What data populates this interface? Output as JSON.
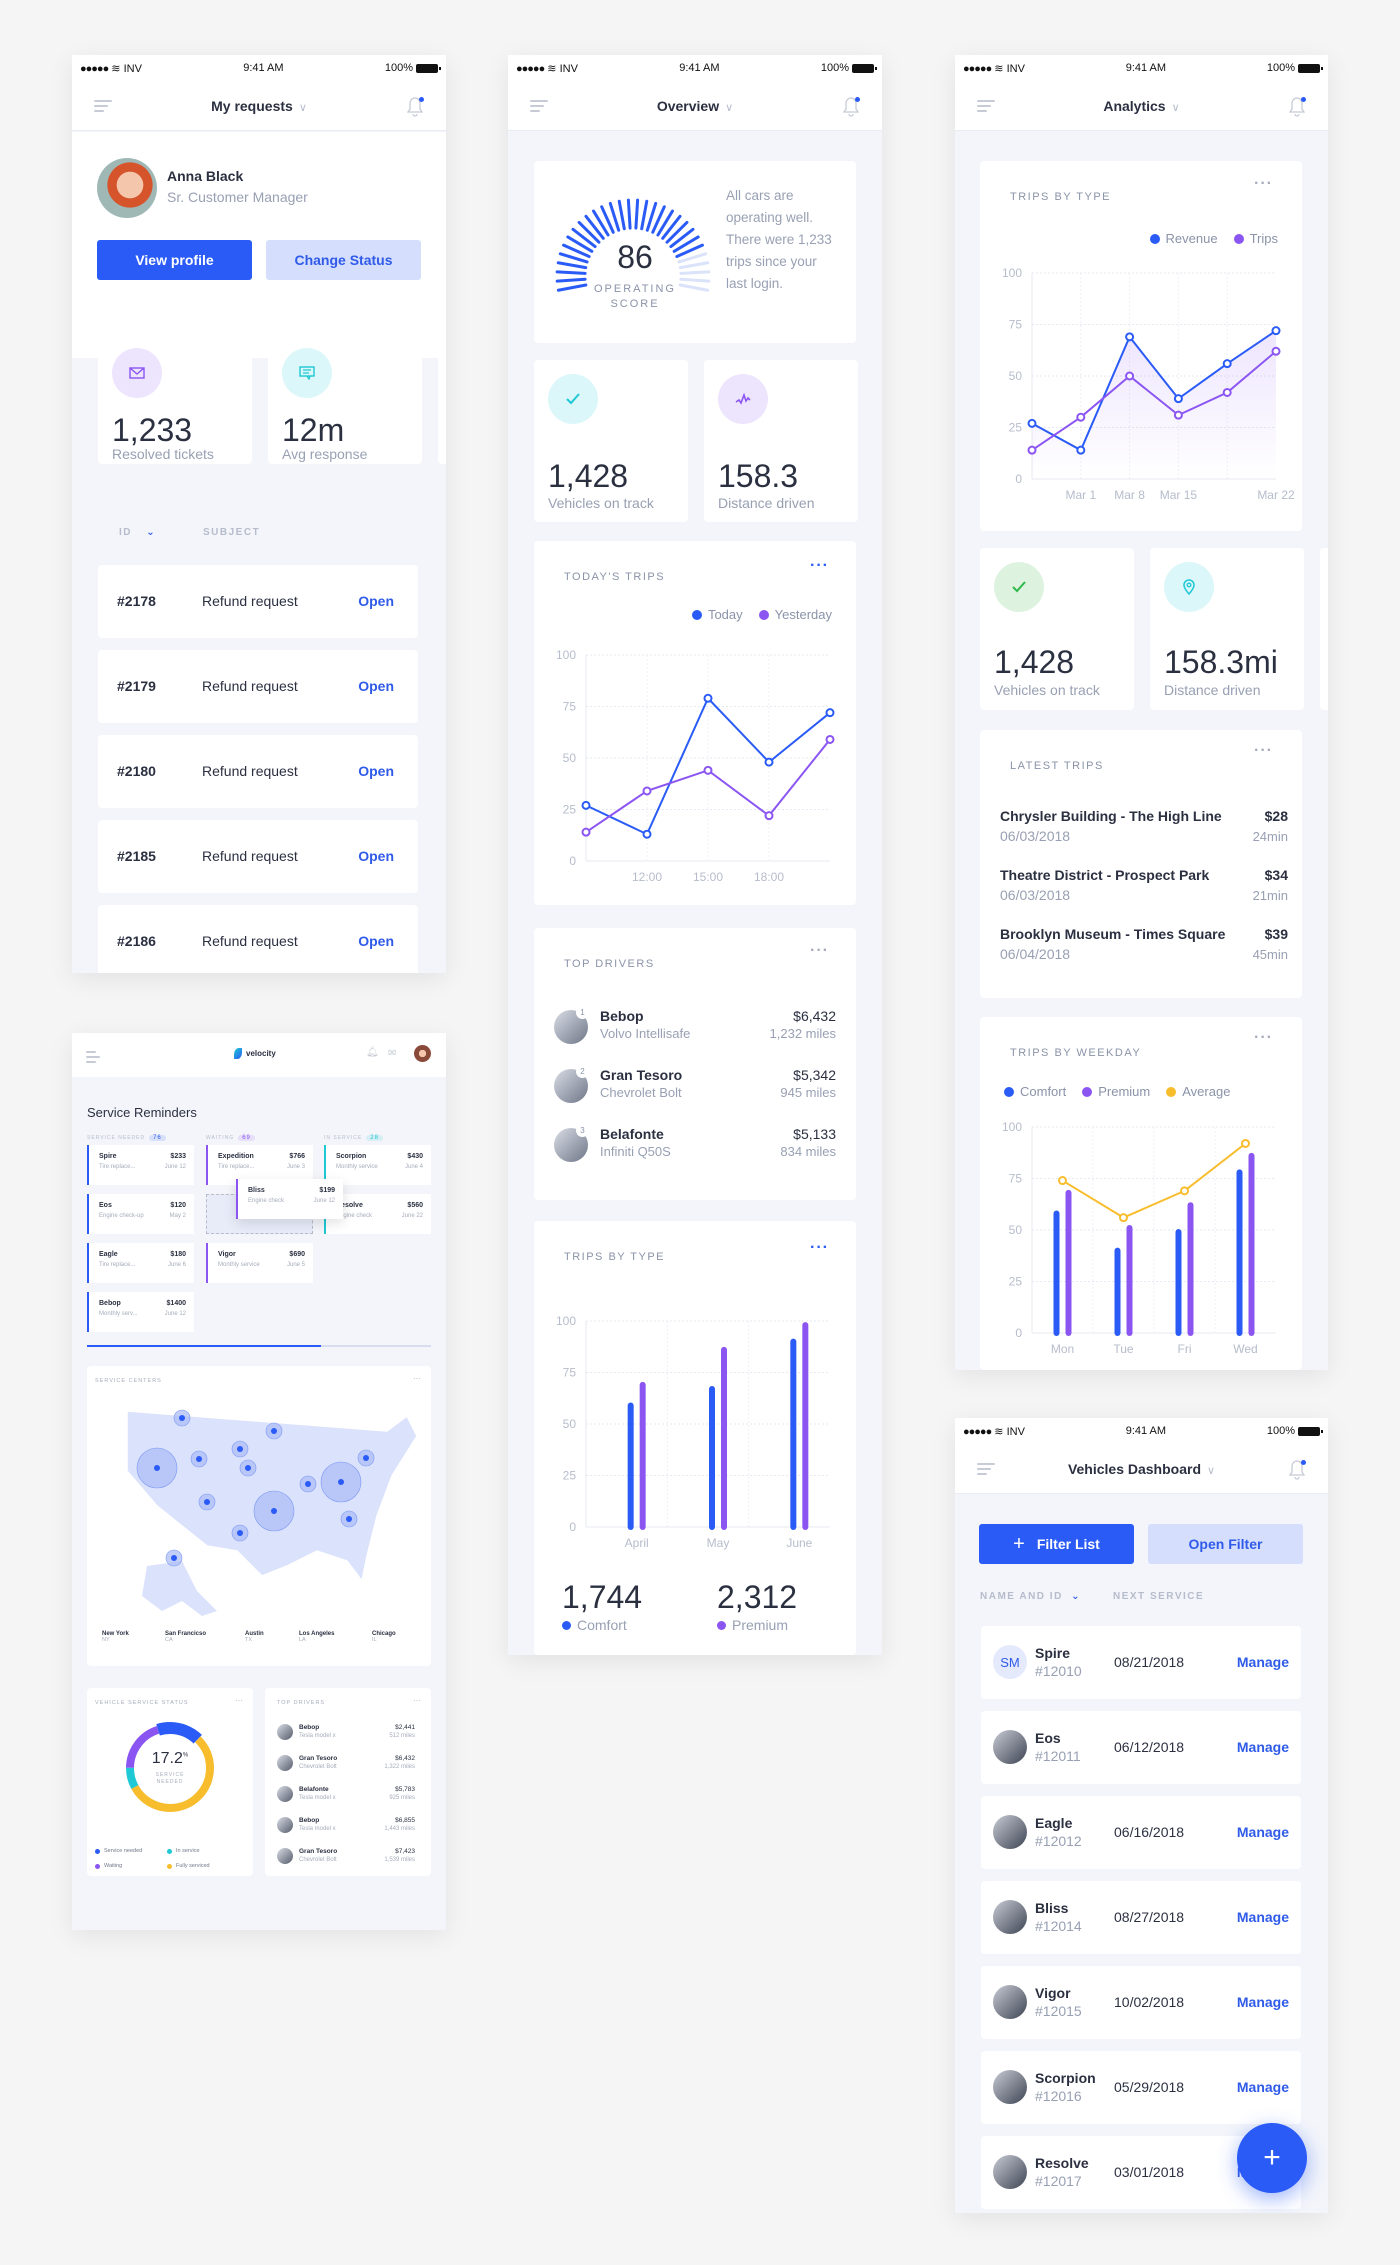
{
  "status_bar": {
    "signal": "●●●●●",
    "carrier": "INV",
    "time": "9:41 AM",
    "battery": "100%"
  },
  "requests_screen": {
    "title": "My requests",
    "profile": {
      "name": "Anna Black",
      "role": "Sr. Customer Manager"
    },
    "buttons": {
      "view_profile": "View profile",
      "change_status": "Change Status"
    },
    "stats": [
      {
        "icon": "mail-icon",
        "value": "1,233",
        "label": "Resolved tickets"
      },
      {
        "icon": "chat-icon",
        "value": "12m",
        "label": "Avg response"
      }
    ],
    "columns": {
      "id": "ID",
      "subject": "SUBJECT"
    },
    "tickets": [
      {
        "id": "#2178",
        "subject": "Refund request",
        "action": "Open"
      },
      {
        "id": "#2179",
        "subject": "Refund request",
        "action": "Open"
      },
      {
        "id": "#2180",
        "subject": "Refund request",
        "action": "Open"
      },
      {
        "id": "#2185",
        "subject": "Refund request",
        "action": "Open"
      },
      {
        "id": "#2186",
        "subject": "Refund request",
        "action": "Open"
      }
    ]
  },
  "overview_screen": {
    "title": "Overview",
    "score": {
      "value": "86",
      "fraction": 0.86,
      "label_1": "OPERATING",
      "label_2": "SCORE",
      "message": "All cars are operating well. There were 1,233 trips since your last login."
    },
    "stats": [
      {
        "icon": "check-icon",
        "value": "1,428",
        "label": "Vehicles on track"
      },
      {
        "icon": "activity-icon",
        "value": "158.3",
        "label": "Distance driven"
      }
    ],
    "todays_trips_title": "TODAY'S TRIPS",
    "top_drivers": {
      "title": "TOP DRIVERS",
      "drivers": [
        {
          "rank": "1",
          "name": "Bebop",
          "car": "Volvo Intellisafe",
          "amount": "$6,432",
          "miles": "1,232 miles"
        },
        {
          "rank": "2",
          "name": "Gran Tesoro",
          "car": "Chevrolet Bolt",
          "amount": "$5,342",
          "miles": "945 miles"
        },
        {
          "rank": "3",
          "name": "Belafonte",
          "car": "Infiniti Q50S",
          "amount": "$5,133",
          "miles": "834 miles"
        }
      ]
    },
    "trips_by_type_title": "TRIPS BY TYPE",
    "totals": [
      {
        "value": "1,744",
        "label": "Comfort"
      },
      {
        "value": "2,312",
        "label": "Premium"
      }
    ]
  },
  "analytics_screen": {
    "title": "Analytics",
    "trips_by_type_title": "TRIPS BY TYPE",
    "stats": [
      {
        "icon": "check-icon",
        "value": "1,428",
        "label": "Vehicles on track"
      },
      {
        "icon": "location-pin-icon",
        "value": "158.3mi",
        "label": "Distance driven"
      }
    ],
    "latest_trips": {
      "title": "LATEST TRIPS",
      "trips": [
        {
          "route": "Chrysler Building - The High Line",
          "price": "$28",
          "date": "06/03/2018",
          "duration": "24min"
        },
        {
          "route": "Theatre District - Prospect Park",
          "price": "$34",
          "date": "06/03/2018",
          "duration": "21min"
        },
        {
          "route": "Brooklyn Museum - Times Square",
          "price": "$39",
          "date": "06/04/2018",
          "duration": "45min"
        }
      ]
    },
    "weekday_title": "TRIPS BY WEEKDAY"
  },
  "vehicles_screen": {
    "title": "Vehicles Dashboard",
    "buttons": {
      "filter_list": "Filter List",
      "open_filter": "Open Filter"
    },
    "columns": {
      "name": "NAME AND ID",
      "next_service": "NEXT SERVICE"
    },
    "vehicles": [
      {
        "initials": "SM",
        "name": "Spire",
        "id": "#12010",
        "date": "08/21/2018",
        "action": "Manage"
      },
      {
        "initials": "",
        "name": "Eos",
        "id": "#12011",
        "date": "06/12/2018",
        "action": "Manage"
      },
      {
        "initials": "",
        "name": "Eagle",
        "id": "#12012",
        "date": "06/16/2018",
        "action": "Manage"
      },
      {
        "initials": "",
        "name": "Bliss",
        "id": "#12014",
        "date": "08/27/2018",
        "action": "Manage"
      },
      {
        "initials": "",
        "name": "Vigor",
        "id": "#12015",
        "date": "10/02/2018",
        "action": "Manage"
      },
      {
        "initials": "",
        "name": "Scorpion",
        "id": "#12016",
        "date": "05/29/2018",
        "action": "Manage"
      },
      {
        "initials": "",
        "name": "Resolve",
        "id": "#12017",
        "date": "03/01/2018",
        "action": "Manage"
      }
    ],
    "fab": "+"
  },
  "desktop_screen": {
    "brand": "velocity",
    "heading": "Service Reminders",
    "columns": [
      {
        "title": "SERVICE NEEDED",
        "count": "76",
        "color": "#2a5bf6",
        "cards": [
          {
            "name": "Spire",
            "price": "$233",
            "desc": "Tire replace...",
            "date": "June 12"
          },
          {
            "name": "Eos",
            "price": "$120",
            "desc": "Engine check-up",
            "date": "May 2"
          },
          {
            "name": "Eagle",
            "price": "$180",
            "desc": "Tire replace...",
            "date": "June 6"
          },
          {
            "name": "Bebop",
            "price": "$1400",
            "desc": "Monthly serv...",
            "date": "June 12"
          }
        ]
      },
      {
        "title": "WAITING",
        "count": "69",
        "color": "#8b55f2",
        "cards": [
          {
            "name": "Expedition",
            "price": "$766",
            "desc": "Tire replace...",
            "date": "June 3"
          },
          {
            "name": "Vigor",
            "price": "$690",
            "desc": "Monthly service",
            "date": "June 5"
          }
        ]
      },
      {
        "title": "IN SERVICE",
        "count": "28",
        "color": "#1ec8d4",
        "cards": [
          {
            "name": "Scorpion",
            "price": "$430",
            "desc": "Monthly service",
            "date": "June 4"
          },
          {
            "name": "Resolve",
            "price": "$560",
            "desc": "Engine check",
            "date": "June 22"
          }
        ]
      }
    ],
    "dragging_card": {
      "name": "Bliss",
      "price": "$199",
      "desc": "Engine check",
      "date": "June 12"
    },
    "scroll_progress": 0.68,
    "service_centers": {
      "title": "SERVICE CENTERS",
      "cities": [
        {
          "name": "New York",
          "code": "NY"
        },
        {
          "name": "San Francicso",
          "code": "CA"
        },
        {
          "name": "Austin",
          "code": "TX"
        },
        {
          "name": "Los Angeles",
          "code": "LA"
        },
        {
          "name": "Chicago",
          "code": "IL"
        }
      ]
    },
    "service_status": {
      "title": "VEHICLE SERVICE STATUS",
      "value": "17.2",
      "unit": "%",
      "label_1": "SERVICE",
      "label_2": "NEEDED",
      "segments": [
        {
          "label": "Service needed",
          "percent": 17.2,
          "color": "#2a5bf6"
        },
        {
          "label": "In service",
          "percent": 8,
          "color": "#1ec8d4"
        },
        {
          "label": "Waiting",
          "percent": 20,
          "color": "#8b55f2"
        },
        {
          "label": "Fully serviced",
          "percent": 54.8,
          "color": "#f8bd2c"
        }
      ]
    },
    "top_drivers": {
      "title": "TOP DRIVERS",
      "drivers": [
        {
          "rank": "1",
          "name": "Bebop",
          "car": "Tesla model x",
          "amount": "$2,441",
          "miles": "512 miles"
        },
        {
          "rank": "2",
          "name": "Gran Tesoro",
          "car": "Chevrolet Bolt",
          "amount": "$6,432",
          "miles": "1,322 miles"
        },
        {
          "rank": "3",
          "name": "Belafonte",
          "car": "Tesla model x",
          "amount": "$5,783",
          "miles": "925 miles"
        },
        {
          "rank": "4",
          "name": "Bebop",
          "car": "Tesla model x",
          "amount": "$6,855",
          "miles": "1,443 miles"
        },
        {
          "rank": "5",
          "name": "Gran Tesoro",
          "car": "Chevrolet Bolt",
          "amount": "$7,423",
          "miles": "1,539 miles"
        }
      ]
    }
  },
  "colors": {
    "primary": "#2a5bf6",
    "purple": "#8b55f2",
    "yellow": "#f8bd2c",
    "cyan": "#1ec8d4"
  },
  "chart_data": [
    {
      "id": "todays_trips",
      "type": "line",
      "title": "TODAY'S TRIPS",
      "x": [
        "",
        "12:00",
        "15:00",
        "18:00",
        ""
      ],
      "series": [
        {
          "name": "Today",
          "color": "#2a5bf6",
          "values": [
            27,
            13,
            79,
            48,
            72
          ]
        },
        {
          "name": "Yesterday",
          "color": "#8b55f2",
          "values": [
            14,
            34,
            44,
            22,
            59
          ]
        }
      ],
      "ylim": [
        0,
        100
      ],
      "yticks": [
        0,
        25,
        50,
        75,
        100
      ],
      "grid": true,
      "legend": "top-right"
    },
    {
      "id": "overview_trips_by_type",
      "type": "bar",
      "title": "TRIPS BY TYPE",
      "categories": [
        "April",
        "May",
        "June"
      ],
      "series": [
        {
          "name": "Comfort",
          "color": "#2a5bf6",
          "values": [
            59,
            67,
            90
          ]
        },
        {
          "name": "Premium",
          "color": "#8b55f2",
          "values": [
            69,
            86,
            98
          ]
        }
      ],
      "ylim": [
        0,
        100
      ],
      "yticks": [
        0,
        25,
        50,
        75,
        100
      ],
      "grid": true,
      "legend": "bottom"
    },
    {
      "id": "analytics_trips_by_type",
      "type": "area",
      "title": "TRIPS BY TYPE",
      "x": [
        "",
        "Mar 1",
        "Mar 8",
        "Mar 15",
        "",
        "Mar 22"
      ],
      "series": [
        {
          "name": "Revenue",
          "color": "#2a5bf6",
          "values": [
            27,
            14,
            69,
            39,
            56,
            72
          ]
        },
        {
          "name": "Trips",
          "color": "#8b55f2",
          "values": [
            14,
            30,
            50,
            31,
            42,
            62
          ]
        }
      ],
      "ylim": [
        0,
        100
      ],
      "yticks": [
        0,
        25,
        50,
        75,
        100
      ],
      "grid": true,
      "legend": "top-right"
    },
    {
      "id": "trips_by_weekday",
      "type": "bar",
      "title": "TRIPS BY WEEKDAY",
      "categories": [
        "Mon",
        "Tue",
        "Fri",
        "Wed"
      ],
      "series": [
        {
          "name": "Comfort",
          "color": "#2a5bf6",
          "values": [
            58,
            40,
            49,
            78
          ]
        },
        {
          "name": "Premium",
          "color": "#8b55f2",
          "values": [
            68,
            51,
            62,
            86
          ]
        },
        {
          "name": "Average",
          "color": "#f8bd2c",
          "type": "line",
          "values": [
            74,
            56,
            69,
            92
          ]
        }
      ],
      "ylim": [
        0,
        100
      ],
      "yticks": [
        0,
        25,
        50,
        75,
        100
      ],
      "grid": true,
      "legend": "top"
    }
  ]
}
